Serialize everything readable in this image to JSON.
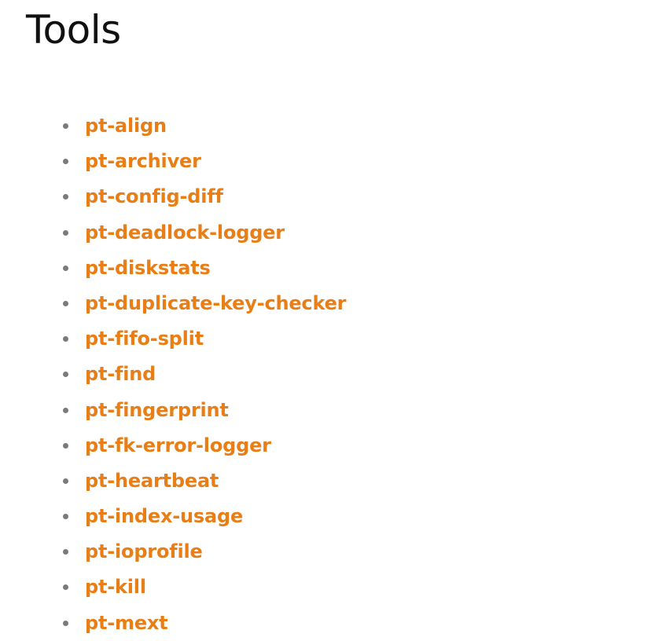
{
  "page": {
    "title": "Tools"
  },
  "tools": [
    {
      "label": "pt-align"
    },
    {
      "label": "pt-archiver"
    },
    {
      "label": "pt-config-diff"
    },
    {
      "label": "pt-deadlock-logger"
    },
    {
      "label": "pt-diskstats"
    },
    {
      "label": "pt-duplicate-key-checker"
    },
    {
      "label": "pt-fifo-split"
    },
    {
      "label": "pt-find"
    },
    {
      "label": "pt-fingerprint"
    },
    {
      "label": "pt-fk-error-logger"
    },
    {
      "label": "pt-heartbeat"
    },
    {
      "label": "pt-index-usage"
    },
    {
      "label": "pt-ioprofile"
    },
    {
      "label": "pt-kill"
    },
    {
      "label": "pt-mext"
    }
  ],
  "colors": {
    "link": "#e87e15",
    "title": "#111111",
    "bullet": "#7a7a7a",
    "background": "#ffffff"
  },
  "icons": {
    "bullet": "bullet-icon"
  }
}
